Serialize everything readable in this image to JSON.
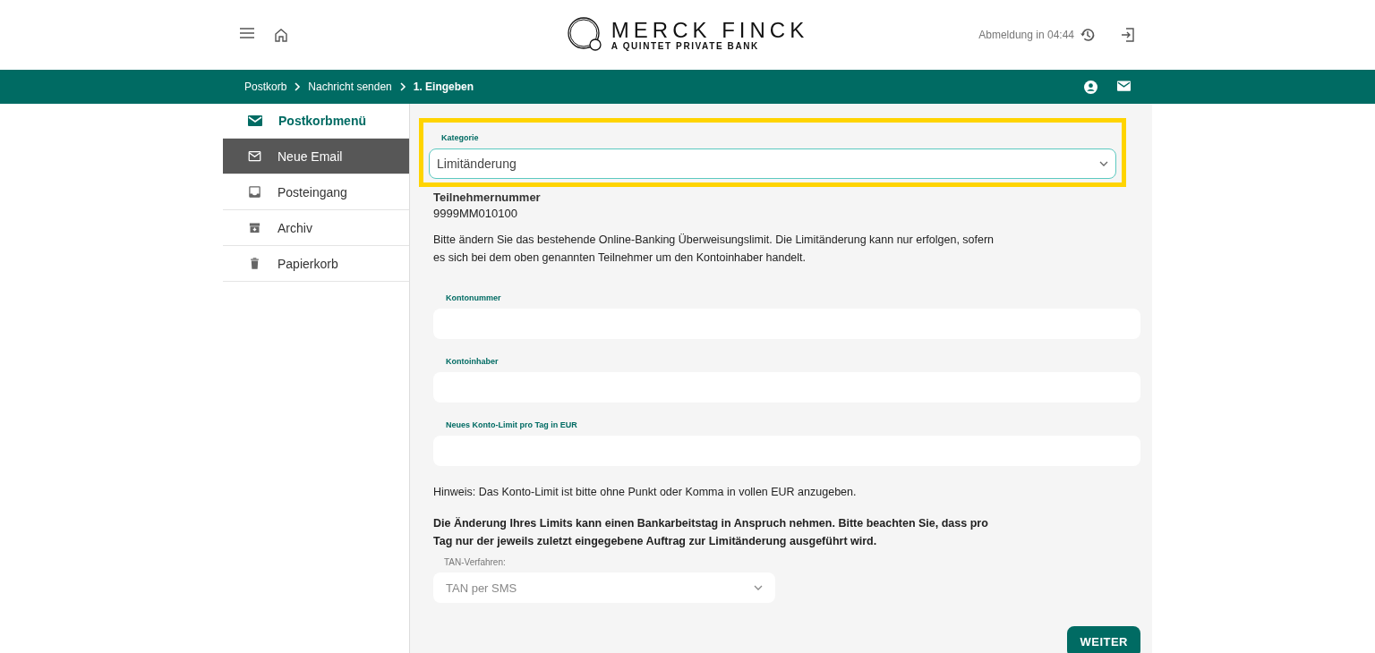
{
  "header": {
    "logo": {
      "name": "MERCK FINCK",
      "tagline": "A QUINTET PRIVATE BANK"
    },
    "logout_timer": "Abmeldung in 04:44"
  },
  "breadcrumb": [
    "Postkorb",
    "Nachricht senden",
    "1. Eingeben"
  ],
  "sidebar": {
    "title": "Postkorbmenü",
    "items": [
      {
        "label": "Neue Email",
        "selected": true
      },
      {
        "label": "Posteingang",
        "selected": false
      },
      {
        "label": "Archiv",
        "selected": false
      },
      {
        "label": "Papierkorb",
        "selected": false
      }
    ]
  },
  "form": {
    "category": {
      "label": "Kategorie",
      "value": "Limitänderung",
      "highlighted": true
    },
    "participant": {
      "label": "Teilnehmernummer",
      "value": "9999MM010100"
    },
    "intro": "Bitte ändern Sie das bestehende Online-Banking Überweisungslimit. Die Limitänderung kann nur erfolgen, sofern es sich bei dem oben genannten Teilnehmer um den Kontoinhaber handelt.",
    "fields": [
      {
        "label": "Kontonummer"
      },
      {
        "label": "Kontoinhaber"
      },
      {
        "label": "Neues Konto-Limit pro Tag in EUR"
      }
    ],
    "hint": "Hinweis: Das Konto-Limit ist bitte ohne Punkt oder Komma in vollen EUR anzugeben.",
    "notice": "Die Änderung Ihres Limits kann einen Bankarbeitstag in Anspruch nehmen. Bitte beachten Sie, dass pro Tag nur der jeweils zuletzt eingegebene Auftrag zur Limitänderung ausgeführt wird.",
    "tan": {
      "label": "TAN-Verfahren:",
      "value": "TAN per SMS"
    },
    "submit": "WEITER"
  }
}
